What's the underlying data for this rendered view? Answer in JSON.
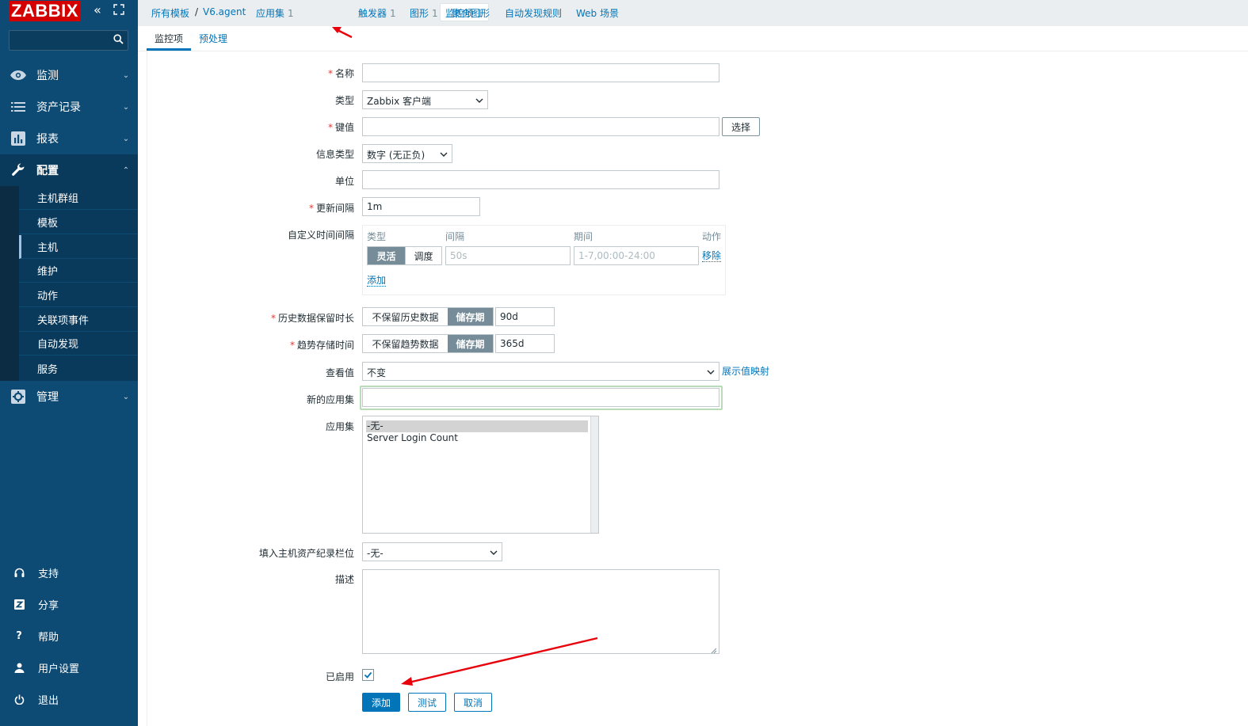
{
  "app": {
    "logo_text": "ZABBIX"
  },
  "sidebar": {
    "sections": [
      {
        "label": "监测",
        "icon": "eye-icon"
      },
      {
        "label": "资产记录",
        "icon": "list-icon"
      },
      {
        "label": "报表",
        "icon": "bar-chart-icon"
      },
      {
        "label": "配置",
        "icon": "wrench-icon"
      },
      {
        "label": "管理",
        "icon": "gear-icon"
      }
    ],
    "config_submenu": [
      "主机群组",
      "模板",
      "主机",
      "维护",
      "动作",
      "关联项事件",
      "自动发现",
      "服务"
    ],
    "footer": [
      {
        "label": "支持",
        "icon": "headset-icon"
      },
      {
        "label": "分享",
        "icon": "share-z-icon"
      },
      {
        "label": "帮助",
        "icon": "help-icon"
      },
      {
        "label": "用户设置",
        "icon": "user-icon"
      },
      {
        "label": "退出",
        "icon": "power-icon"
      }
    ]
  },
  "breadcrumb": {
    "all_templates": "所有模板",
    "separator": "/",
    "template": "V6.agent",
    "applications": "应用集",
    "applications_count": "1",
    "items": "监控项",
    "items_count": "1",
    "triggers": "触发器",
    "triggers_count": "1",
    "graphs": "图形",
    "graphs_count": "1",
    "screens": "聚合图形",
    "discovery": "自动发现规则",
    "web": "Web 场景"
  },
  "tabs": {
    "items": "监控项",
    "preprocessing": "预处理"
  },
  "form": {
    "name": {
      "label": "名称",
      "value": ""
    },
    "type": {
      "label": "类型",
      "value": "Zabbix 客户端"
    },
    "key": {
      "label": "键值",
      "value": "",
      "select_button": "选择"
    },
    "info_type": {
      "label": "信息类型",
      "value": "数字 (无正负)"
    },
    "units": {
      "label": "单位",
      "value": ""
    },
    "update_interval": {
      "label": "更新间隔",
      "value": "1m"
    },
    "custom_intervals": {
      "label": "自定义时间间隔",
      "col_type": "类型",
      "col_interval": "间隔",
      "col_period": "期间",
      "col_action": "动作",
      "flexible": "灵活",
      "scheduling": "调度",
      "interval_placeholder": "50s",
      "period_placeholder": "1-7,00:00-24:00",
      "remove": "移除",
      "add": "添加"
    },
    "history": {
      "label": "历史数据保留时长",
      "no_keep": "不保留历史数据",
      "storage": "储存期",
      "value": "90d"
    },
    "trends": {
      "label": "趋势存储时间",
      "no_keep": "不保留趋势数据",
      "storage": "储存期",
      "value": "365d"
    },
    "show_value": {
      "label": "查看值",
      "value": "不变",
      "link": "展示值映射"
    },
    "new_application": {
      "label": "新的应用集",
      "value": ""
    },
    "applications": {
      "label": "应用集",
      "options": [
        "-无-",
        "Server Login Count"
      ]
    },
    "inventory": {
      "label": "填入主机资产纪录栏位",
      "value": "-无-"
    },
    "description": {
      "label": "描述",
      "value": ""
    },
    "enabled": {
      "label": "已启用",
      "checked": true
    },
    "buttons": {
      "add": "添加",
      "test": "测试",
      "cancel": "取消"
    }
  },
  "colors": {
    "sidebar": "#0e4b74",
    "accent": "#0275b8",
    "logo": "#d40000",
    "annotation_arrow": "#e8000b"
  }
}
